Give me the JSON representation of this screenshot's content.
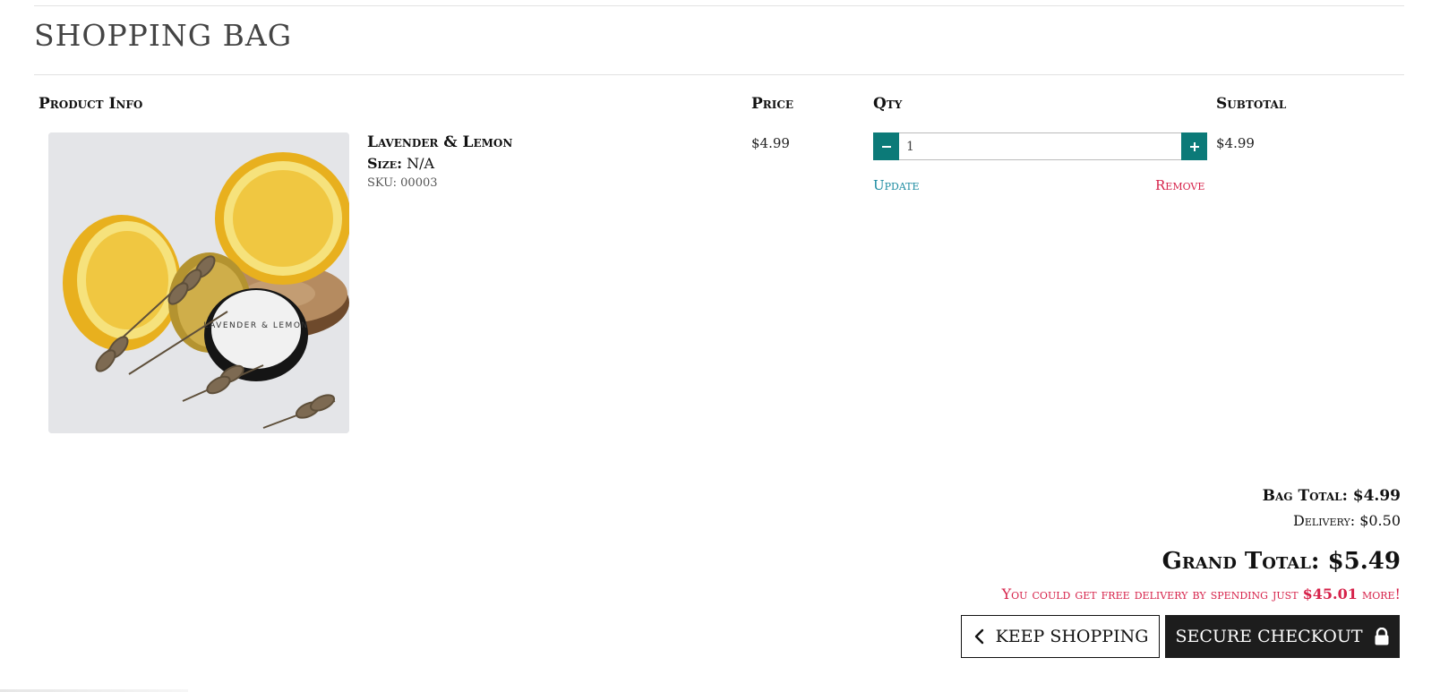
{
  "page": {
    "title": "SHOPPING BAG"
  },
  "table": {
    "headers": {
      "product_info": "Product Info",
      "price": "Price",
      "qty": "Qty",
      "subtotal": "Subtotal"
    }
  },
  "item": {
    "name": "Lavender & Lemon",
    "size_label": "Size:",
    "size_value": "N/A",
    "sku": "SKU: 00003",
    "price": "$4.99",
    "quantity": "1",
    "subtotal": "$4.99",
    "update_label": "Update",
    "remove_label": "Remove",
    "image_label": "LAVENDER & LEMON"
  },
  "totals": {
    "bag_total": "Bag Total: $4.99",
    "delivery": "Delivery: $0.50",
    "grand_total": "Grand Total: $5.49",
    "free_delivery_prefix": "You could get free delivery by spending just",
    "free_delivery_amount": "$45.01",
    "free_delivery_suffix": "more!"
  },
  "actions": {
    "keep_shopping": "KEEP SHOPPING",
    "secure_checkout": "SECURE CHECKOUT"
  },
  "icons": {
    "minus": "minus-icon",
    "plus": "plus-icon",
    "chevron_left": "chevron-left-icon",
    "lock": "lock-icon"
  },
  "colors": {
    "accent_teal": "#0c7a78",
    "link_blue": "#1a8aa0",
    "alert_red": "#d6224a",
    "dark_button": "#1d1d1d"
  }
}
